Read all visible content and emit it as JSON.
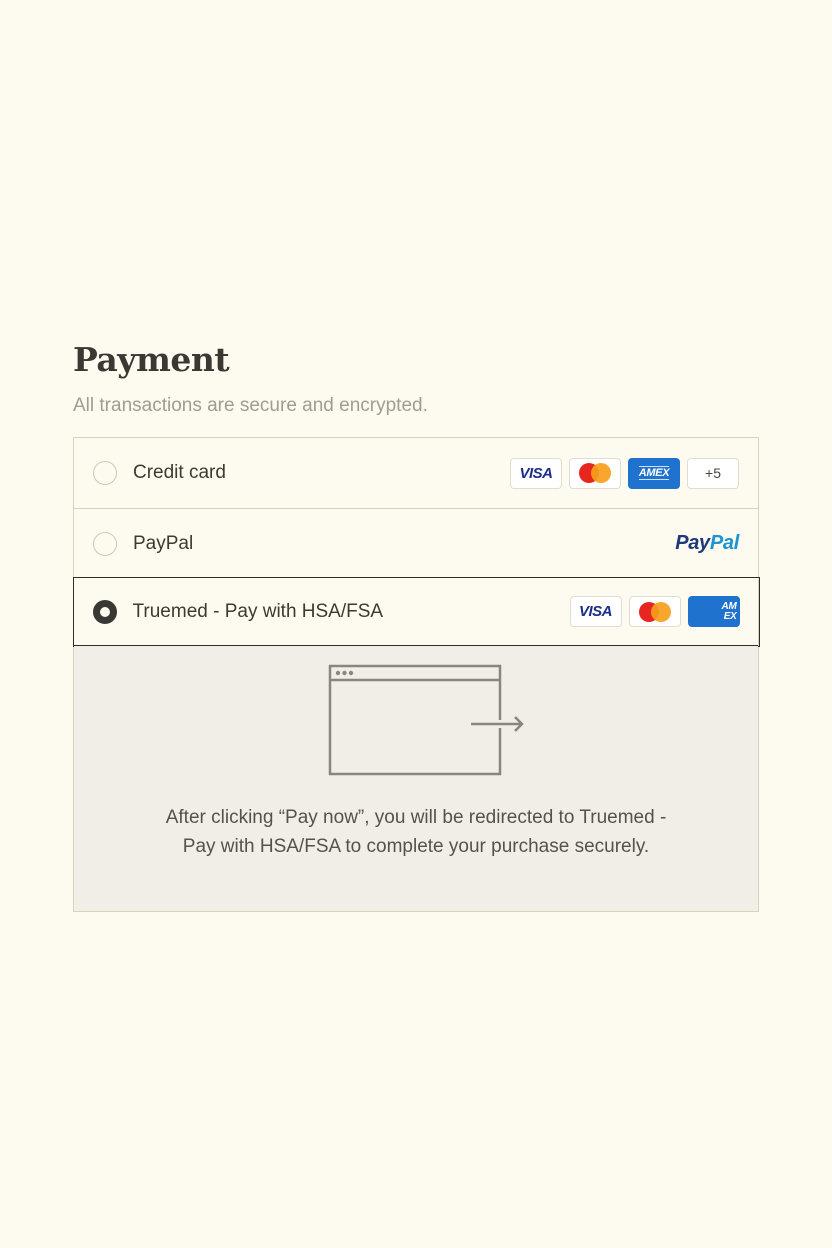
{
  "payment": {
    "title": "Payment",
    "subtitle": "All transactions are secure and encrypted.",
    "options": [
      {
        "label": "Credit card",
        "selected": false,
        "badges": [
          "visa-icon",
          "mastercard-icon",
          "amex-icon"
        ],
        "visa_text": "VISA",
        "amex_text": "AMEX",
        "more_label": "+5"
      },
      {
        "label": "PayPal",
        "selected": false,
        "logo_pay": "Pay",
        "logo_pal": "Pal"
      },
      {
        "label": "Truemed - Pay with HSA/FSA",
        "selected": true,
        "badges": [
          "visa-icon",
          "mastercard-icon",
          "amex-icon"
        ],
        "visa_text": "VISA",
        "amex_text": "AM EX"
      }
    ],
    "redirect": {
      "icon": "browser-redirect-icon",
      "message": "After clicking “Pay now”, you will be redirected to Truemed - Pay with HSA/FSA to complete your purchase securely."
    }
  },
  "colors": {
    "background": "#fdfbef",
    "border": "#d9d2bc",
    "selected_border": "#2f2d29",
    "panel_bg": "#f0eee6",
    "visa_blue": "#1a2e8a",
    "amex_blue": "#1f72cd",
    "paypal_dark": "#1f3a7a",
    "paypal_light": "#1b94d2"
  }
}
